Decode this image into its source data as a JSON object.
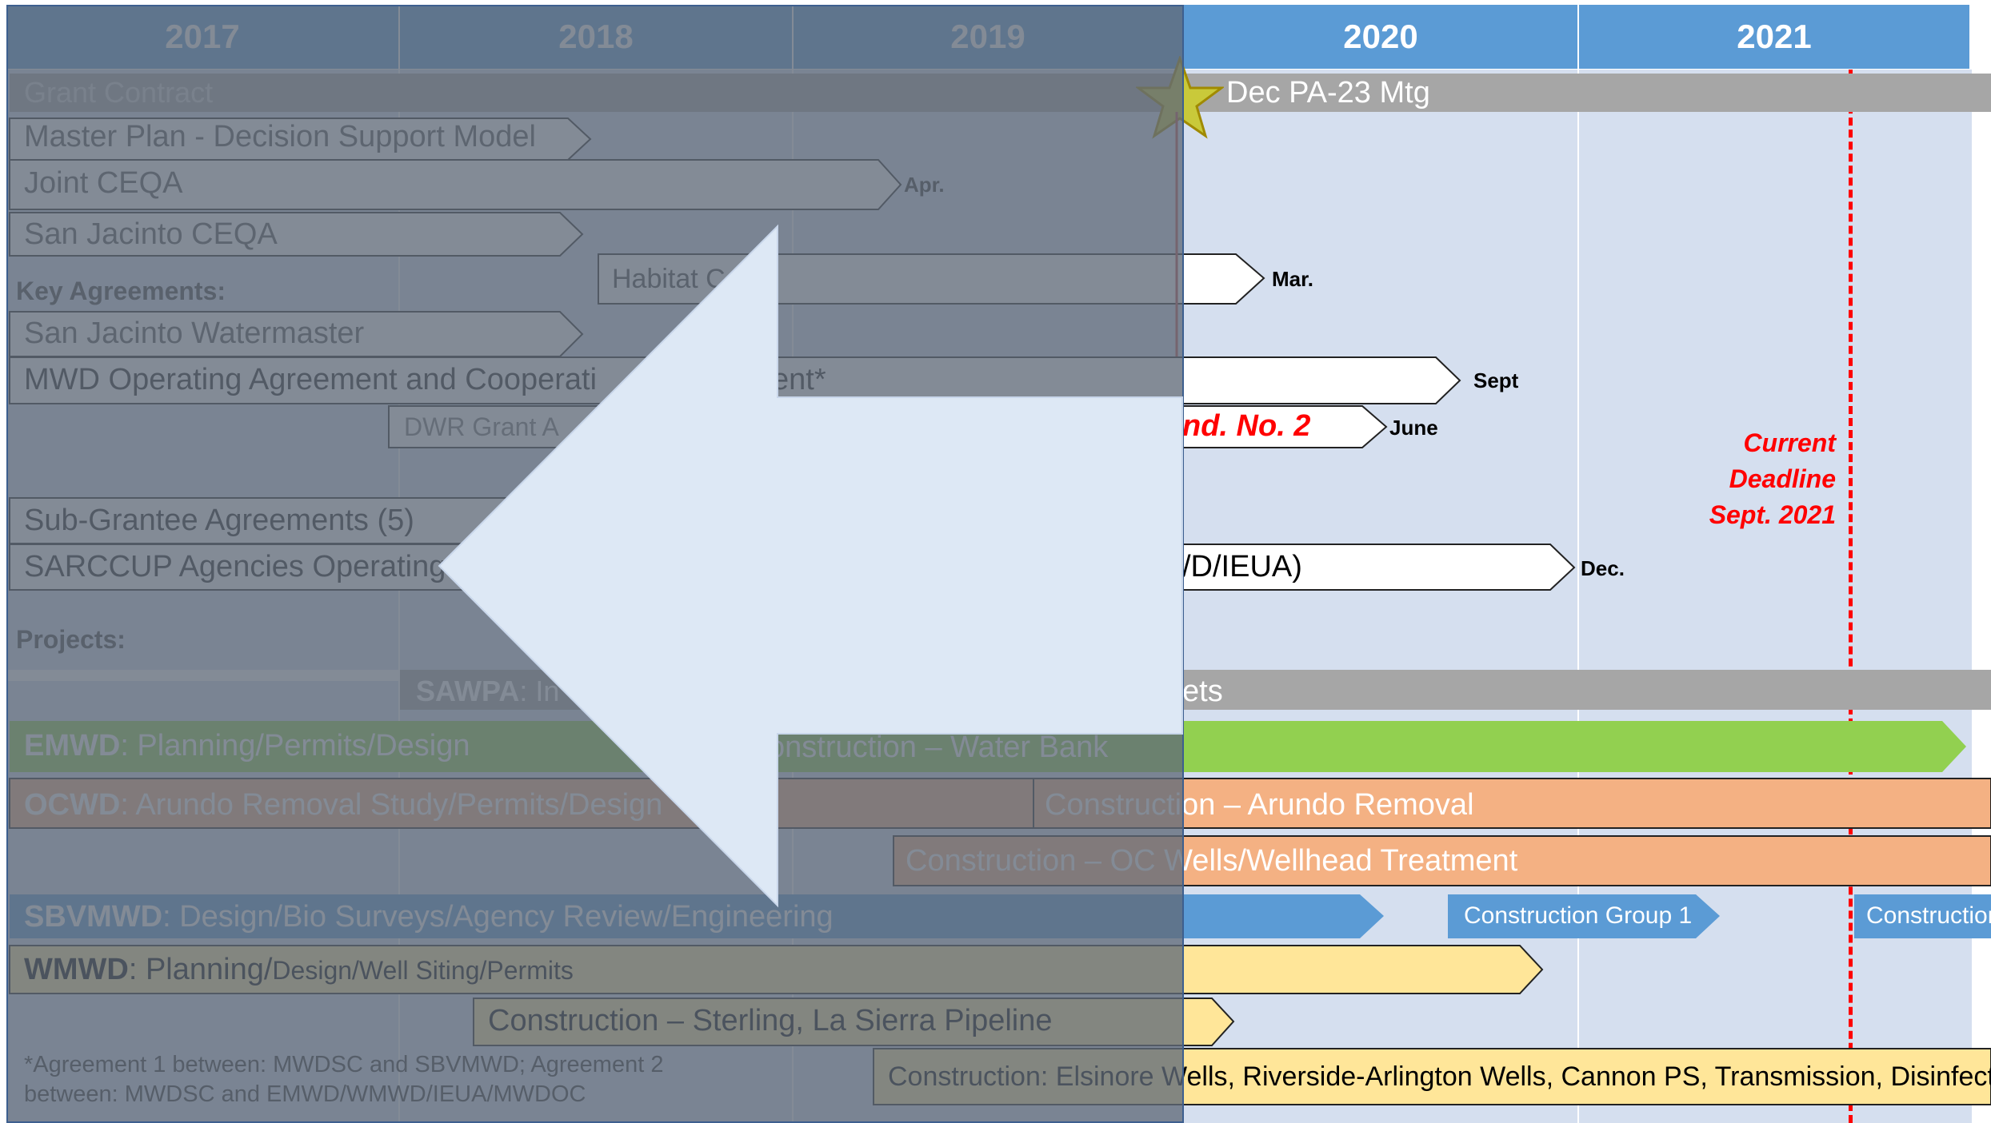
{
  "years": [
    "2017",
    "2018",
    "2019",
    "2020",
    "2021"
  ],
  "section_labels": {
    "key_agreements": "Key Agreements:",
    "projects": "Projects:"
  },
  "bars": {
    "grant_contract": "Grant Contract",
    "dec_mtg": "Dec PA-23 Mtg",
    "master_plan": "Master Plan - Decision Support Model",
    "joint_ceqa": "Joint CEQA",
    "san_jacinto_ceqa": "San Jacinto CEQA",
    "habitat": "Habitat C",
    "san_jacinto_watermaster": "San Jacinto Watermaster",
    "mwd_operating": "MWD Operating Agreement and Cooperati",
    "mwd_operating_tail": "ent*",
    "dwr_grant": "DWR Grant A",
    "amend_no2": "nd. No. 2",
    "sub_grantee": "Sub-Grantee Agreements (5)",
    "sarccup_agencies": "SARCCUP Agencies Operating A",
    "sarccup_tail": "/D/IEUA)",
    "sawpa_label": "SAWPA",
    "sawpa_text": ": In",
    "sawpa_tail": "ets",
    "emwd_label": "EMWD",
    "emwd_text": ": Planning/Permits/Design",
    "emwd_construction": "onstruction – Water Bank",
    "ocwd_label": "OCWD",
    "ocwd_text": ": Arundo Removal Study/Permits/Design",
    "ocwd_construction": "Construction – Arundo Removal",
    "oc_wells": "Construction – OC Wells/Wellhead Treatment",
    "sbvmwd_label": "SBVMWD",
    "sbvmwd_text": ": Design/Bio Surveys/Agency Review/Engineering",
    "construction_group1": "Construction Group 1",
    "construction_right": "Construction",
    "wmwd_label": "WMWD",
    "wmwd_text_a": ": Planning/",
    "wmwd_text_b": "Design/Well Siting/Permits",
    "sterling": "Construction – Sterling, La Sierra Pipeline",
    "elsinore": "Construction: Elsinore Wells, Riverside-Arlington Wells, Cannon PS, Transmission, Disinfectio"
  },
  "milestones": {
    "apr": "Apr.",
    "mar": "Mar.",
    "sept": "Sept",
    "june": "June",
    "dec": "Dec."
  },
  "deadline": {
    "line1": "Current",
    "line2": "Deadline",
    "line3": "Sept. 2021"
  },
  "footnote": {
    "line1": "*Agreement 1 between: MWDSC and SBVMWD; Agreement 2",
    "line2": "between: MWDSC and EMWD/WMWD/IEUA/MWDOC"
  },
  "colors": {
    "header": "#5b9bd5",
    "deadline": "#ff0000",
    "emwd": "#92d050",
    "ocwd": "#f4b183",
    "sbvmwd": "#5b9bd5",
    "wmwd": "#ffe699",
    "gray_bar": "#a6a6a6"
  }
}
